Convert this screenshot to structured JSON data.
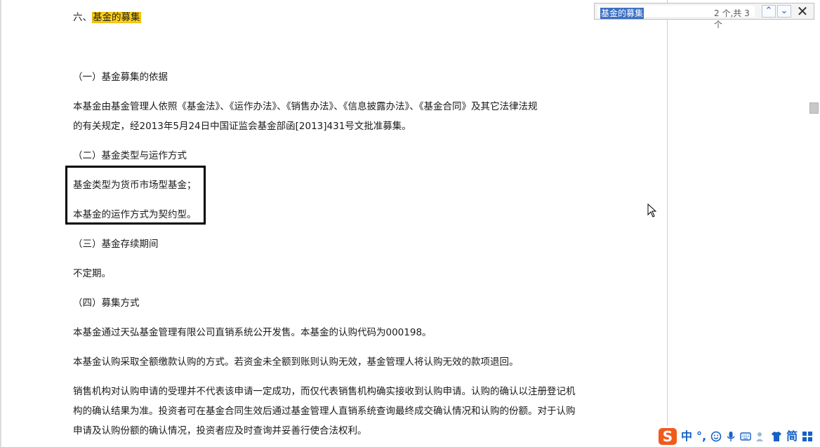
{
  "document": {
    "section_prefix": "六、",
    "section_highlight": "基金的募集",
    "lines": [
      "（一）基金募集的依据",
      "本基金由基金管理人依照《基金法》、《运作办法》、《销售办法》、《信息披露办法》、《基金合同》及其它法律法规",
      "的有关规定，经2013年5月24日中国证监会基金部函[2013]431号文批准募集。",
      "（二）基金类型与运作方式",
      "基金类型为货币市场型基金；",
      "本基金的运作方式为契约型。",
      "（三）基金存续期间",
      "不定期。",
      "（四）募集方式",
      "本基金通过天弘基金管理有限公司直销系统公开发售。本基金的认购代码为000198。",
      "本基金认购采取全额缴款认购的方式。若资金未全额到账则认购无效，基金管理人将认购无效的款项退回。",
      "销售机构对认购申请的受理并不代表该申请一定成功，而仅代表销售机构确实接收到认购申请。认购的确认以注册登记机",
      "构的确认结果为准。投资者可在基金合同生效后通过基金管理人直销系统查询最终成交确认情况和认购的份额。对于认购",
      "申请及认购份额的确认情况，投资者应及时查询并妥善行使合法权利。"
    ]
  },
  "find_bar": {
    "query": "基金的募集",
    "count": "2 个,共 3 个",
    "prev_icon": "chevron-up-icon",
    "next_icon": "chevron-down-icon",
    "close_icon": "close-icon",
    "prev_glyph": "⌃",
    "next_glyph": "⌄",
    "close_glyph": "✕"
  },
  "ime_bar": {
    "logo": "S",
    "mode": "中",
    "punct": "°,",
    "simplified": "简"
  },
  "colors": {
    "highlight": "#ffd21f",
    "selection": "#3b6fc4",
    "accent": "#1561c6",
    "ime_logo": "#f25a1c"
  }
}
